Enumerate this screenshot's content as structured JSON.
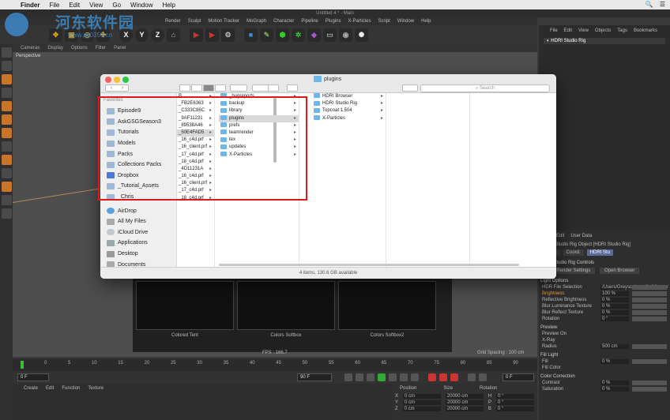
{
  "menubar": {
    "apple": "",
    "items": [
      "Finder",
      "File",
      "Edit",
      "View",
      "Go",
      "Window",
      "Help"
    ]
  },
  "watermark": {
    "text": "河东软件园",
    "url": "www.pc0359.cn"
  },
  "c4d": {
    "title": "Untitled 4 * - Main",
    "menu": [
      "Render",
      "Sculpt",
      "Motion Tracker",
      "MoGraph",
      "Character",
      "Pipeline",
      "Plugins",
      "X-Particles",
      "Script",
      "Window",
      "Help"
    ],
    "axes": [
      "X",
      "Y",
      "Z"
    ],
    "viewport_menu": [
      "Cameras",
      "Display",
      "Options",
      "Filter",
      "Panel"
    ],
    "viewport_label": "Perspective",
    "fps": "FPS : 166.7",
    "grid_spacing": "Grid Spacing : 100 cm",
    "materials": [
      "Colored Tent",
      "Colors Softbox",
      "Colors Softbox2"
    ],
    "timeline_ticks": [
      "0",
      "5",
      "10",
      "15",
      "20",
      "25",
      "30",
      "35",
      "40",
      "45",
      "50",
      "55",
      "60",
      "65",
      "70",
      "75",
      "80",
      "85",
      "90"
    ],
    "frame_start": "0 F",
    "frame_end": "90 F",
    "frame_current": "0 F",
    "mat_menu": [
      "Create",
      "Edit",
      "Function",
      "Texture"
    ],
    "coords_headers": [
      "Position",
      "Size",
      "Rotation"
    ],
    "coords_rows": [
      {
        "axis": "X",
        "pos": "0 cm",
        "size": "20000 cm",
        "rot_axis": "H",
        "rot": "0 °"
      },
      {
        "axis": "Y",
        "pos": "0 cm",
        "size": "20000 cm",
        "rot_axis": "P",
        "rot": "0 °"
      },
      {
        "axis": "Z",
        "pos": "0 cm",
        "size": "20000 cm",
        "rot_axis": "B",
        "rot": "0 °"
      }
    ]
  },
  "right_panel": {
    "menu": [
      "File",
      "Edit",
      "View",
      "Objects",
      "Tags",
      "Bookmarks"
    ],
    "object": "HDRI Studio Rig",
    "attr_menu": [
      "Edit",
      "User Data"
    ],
    "attr_title": "HDRI Studio Rig Object [HDRI Studio Rig]",
    "tabs": [
      "Basic",
      "Coord.",
      "HDRI Stu"
    ],
    "section_controls": "HDRI Studio Rig Controls",
    "btn_render": "Start Render Settings",
    "btn_browser": "Open Browser",
    "section_light": "Light Options",
    "light_rows": [
      {
        "label": "HDR File Selection",
        "value": "/Users/Greyscalegorilla/Library/"
      },
      {
        "label": "Brightness",
        "value": "100 %",
        "hl": true
      },
      {
        "label": "Reflective Brightness",
        "value": "0 %"
      },
      {
        "label": "Blur Luminance Texture",
        "value": "0 %"
      },
      {
        "label": "Blur Reflect Texture",
        "value": "0 %"
      },
      {
        "label": "Rotation",
        "value": "0 °"
      }
    ],
    "section_preview": "Preview",
    "preview_rows": [
      {
        "label": "Preview On",
        "value": ""
      },
      {
        "label": "X-Ray",
        "value": ""
      },
      {
        "label": "Radius",
        "value": "500 cm"
      }
    ],
    "section_fill": "Fill Light",
    "fill_rows": [
      {
        "label": "Fill",
        "value": "0 %"
      },
      {
        "label": "Fill Color",
        "value": ""
      }
    ],
    "section_color": "Color Correction",
    "color_rows": [
      {
        "label": "Contrast",
        "value": "0 %"
      },
      {
        "label": "Saturation",
        "value": "0 %"
      }
    ]
  },
  "finder": {
    "title": "plugins",
    "search_placeholder": "Search",
    "favorites_header": "Favorites",
    "sidebar": [
      {
        "label": "Episode9",
        "icon": "folder-icon"
      },
      {
        "label": "AskGSGSeason3",
        "icon": "folder-icon"
      },
      {
        "label": "Tutorials",
        "icon": "folder-icon"
      },
      {
        "label": "Models",
        "icon": "folder-icon"
      },
      {
        "label": "Packs",
        "icon": "folder-icon"
      },
      {
        "label": "Collections Packs",
        "icon": "folder-icon"
      },
      {
        "label": "Dropbox",
        "icon": "dropbox-icon"
      },
      {
        "label": "_Tutorial_Assets",
        "icon": "folder-icon"
      },
      {
        "label": "_Chris",
        "icon": "folder-icon"
      },
      {
        "label": "AirDrop",
        "icon": "airdrop-icon"
      },
      {
        "label": "All My Files",
        "icon": "files-icon"
      },
      {
        "label": "iCloud Drive",
        "icon": "cloud-icon"
      },
      {
        "label": "Applications",
        "icon": "applications-icon"
      },
      {
        "label": "Desktop",
        "icon": "desktop-icon"
      },
      {
        "label": "Documents",
        "icon": "documents-icon"
      }
    ],
    "col1": [
      "B",
      "_FB2E6363",
      "_C333C86C",
      "_9AF11231",
      "_89538A46",
      "_50E4FAD5",
      "_16_c4d.prf",
      "_16_client.prf",
      "_17_c4d.prf",
      "_18_c4d.prf",
      "_4D11231A",
      "_16_c4d.prf",
      "_16_client.prf",
      "_17_c4d.prf",
      "_18_c4d.prf"
    ],
    "col1_selected": 5,
    "col2": [
      "_bugreports",
      "backup",
      "library",
      "plugins",
      "prefs",
      "teamrender",
      "tex",
      "updates",
      "X-Particles"
    ],
    "col2_selected": 3,
    "col3": [
      "HDRI Browser",
      "HDRI Studio Rig",
      "Topcoat 1.504",
      "X-Particles"
    ],
    "status": "4 items, 130.6 GB available"
  }
}
